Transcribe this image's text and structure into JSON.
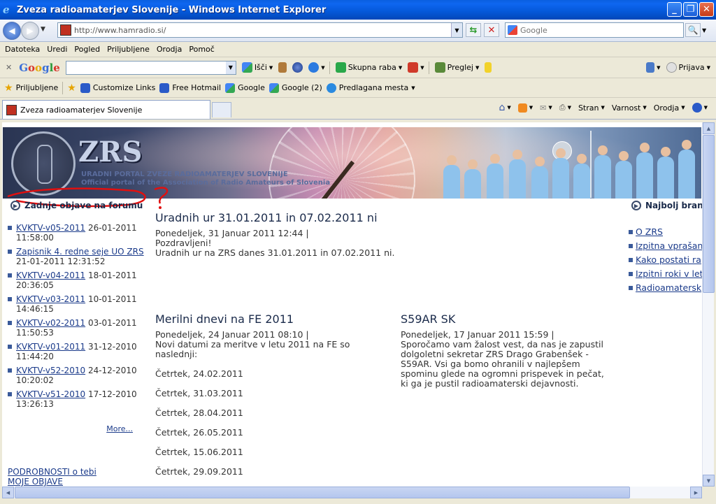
{
  "window": {
    "title": "Zveza radioamaterjev Slovenije - Windows Internet Explorer",
    "minimize": "_",
    "maximize": "❐",
    "close": "✕"
  },
  "address": {
    "url": "http://www.hamradio.si/",
    "search_placeholder": "Google"
  },
  "menu": [
    "Datoteka",
    "Uredi",
    "Pogled",
    "Priljubljene",
    "Orodja",
    "Pomoč"
  ],
  "google_toolbar": {
    "logo": [
      "G",
      "o",
      "o",
      "g",
      "l",
      "e"
    ],
    "search_label": "Išči",
    "share_label": "Skupna raba",
    "review_label": "Preglej",
    "signin_label": "Prijava"
  },
  "favorites": {
    "title": "Priljubljene",
    "items": [
      "Customize Links",
      "Free Hotmail",
      "Google",
      "Google (2)",
      "Predlagana mesta"
    ]
  },
  "tab": {
    "label": "Zveza radioamaterjev Slovenije"
  },
  "command_bar": {
    "page": "Stran",
    "safety": "Varnost",
    "tools": "Orodja"
  },
  "banner": {
    "logo": "ZRS",
    "line1": "URADNI PORTAL ZVEZE RADIOAMATERJEV SLOVENIJE",
    "line2": "Official portal of the Association of Radio Amateurs of Slovenia"
  },
  "left_sidebar": {
    "heading": "Zadnje objave na forumu",
    "posts": [
      {
        "title": "KVKTV-v05-2011",
        "date": "26-01-2011 11:58:00"
      },
      {
        "title": "Zapisnik 4. redne seje UO ZRS",
        "date": "21-01-2011 12:31:52"
      },
      {
        "title": "KVKTV-v04-2011",
        "date": "18-01-2011 20:36:05"
      },
      {
        "title": "KVKTV-v03-2011",
        "date": "10-01-2011 14:46:15"
      },
      {
        "title": "KVKTV-v02-2011",
        "date": "03-01-2011 11:50:53"
      },
      {
        "title": "KVKTV-v01-2011",
        "date": "31-12-2010 11:44:20"
      },
      {
        "title": "KVKTV-v52-2010",
        "date": "24-12-2010 10:20:02"
      },
      {
        "title": "KVKTV-v51-2010",
        "date": "17-12-2010 13:26:13"
      }
    ],
    "more": "More...",
    "profile_line1": "PODROBNOSTI o tebi",
    "profile_line2": "MOJE OBJAVE"
  },
  "articles": {
    "a1": {
      "title": "Uradnih ur 31.01.2011 in 07.02.2011 ni",
      "meta": "Ponedeljek, 31 Januar 2011 12:44 |",
      "line1": "Pozdravljeni!",
      "line2": "Uradnih ur na ZRS danes 31.01.2011 in 07.02.2011 ni."
    },
    "a2": {
      "title": "Merilni dnevi na FE 2011",
      "meta": "Ponedeljek, 24 Januar 2011 08:10 |",
      "intro": "Novi datumi za meritve v letu 2011 na FE so naslednji:",
      "dates": [
        "Četrtek, 24.02.2011",
        "Četrtek, 31.03.2011",
        "Četrtek, 28.04.2011",
        "Četrtek, 26.05.2011",
        "Četrtek, 15.06.2011",
        "Četrtek, 29.09.2011"
      ]
    },
    "a3": {
      "title": "S59AR SK",
      "meta": "Ponedeljek, 17 Januar 2011 15:59 |",
      "body": "Sporočamo vam žalost vest, da nas je zapustil dolgoletni sekretar ZRS Drago Grabenšek - S59AR. Vsi ga bomo ohranili v najlepšem spominu glede na ogromni prispevek in pečat, ki ga je pustil radioamaterski dejavnosti."
    }
  },
  "right_sidebar": {
    "heading": "Najbolj bran",
    "links": [
      "O ZRS",
      "Izpitna vprašan",
      "Kako postati ra",
      "Izpitni roki v let",
      "Radioamatersk"
    ]
  },
  "colors": {
    "title_bar": "#0458d8",
    "link": "#1a3a8a",
    "scribble": "#e01010"
  }
}
